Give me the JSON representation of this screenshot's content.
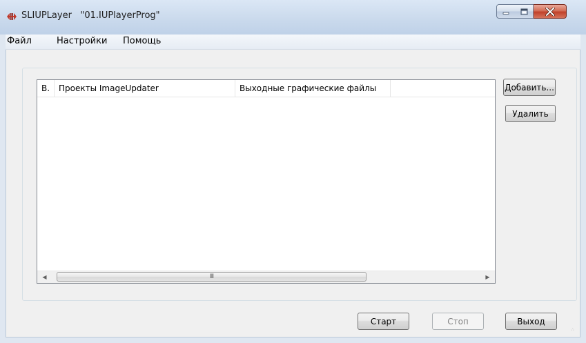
{
  "window": {
    "app_name": "SLIUPLayer",
    "project_name": "\"01.IUPlayerProg\"",
    "icon": "app-logo-icon",
    "controls": {
      "minimize_icon": "minimize-icon",
      "maximize_icon": "maximize-icon",
      "close_icon": "close-icon"
    }
  },
  "menu": {
    "items": [
      {
        "label": "Файл"
      },
      {
        "label": "Настройки"
      },
      {
        "label": "Помощь"
      }
    ]
  },
  "list": {
    "columns": [
      {
        "label": "В."
      },
      {
        "label": "Проекты ImageUpdater"
      },
      {
        "label": "Выходные графические файлы"
      }
    ],
    "rows": [],
    "scrollbar": {
      "thumb_grip": "III"
    }
  },
  "side_buttons": {
    "add_label": "Добавить...",
    "delete_label": "Удалить"
  },
  "bottom_buttons": {
    "start_label": "Старт",
    "stop_label": "Стоп",
    "exit_label": "Выход"
  },
  "colors": {
    "close_button": "#c0412a",
    "titlebar": "#c9d9ec"
  }
}
